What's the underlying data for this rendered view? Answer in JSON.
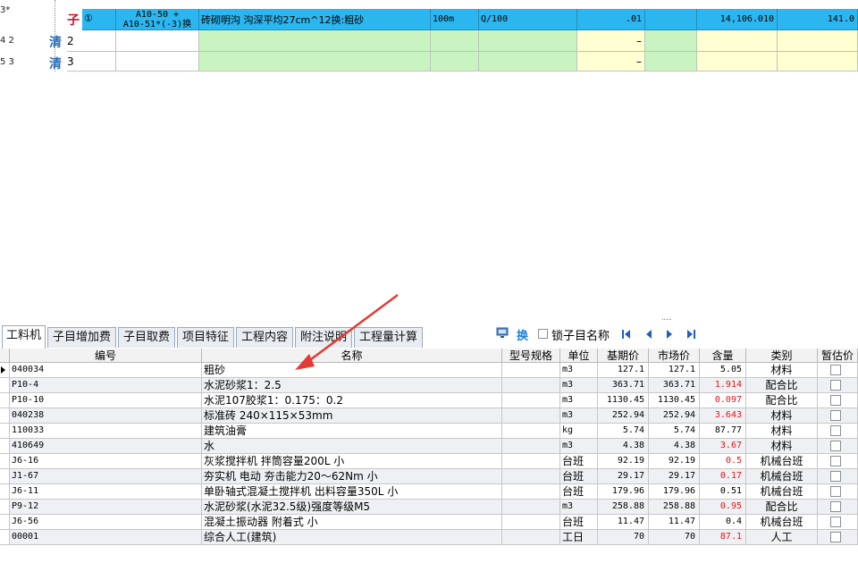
{
  "top_grid": {
    "row_numbers": [
      "3*",
      "4 2",
      "5 3"
    ],
    "rows": [
      {
        "marker": "子",
        "index": "①",
        "code_line1": "A10-50 +",
        "code_line2": "A10-51*(-3)换",
        "name": "砖砌明沟 沟深平均27cm^12换:粗砂",
        "unit": "100m",
        "quantity": "Q/100",
        "qty_value": ".01",
        "price": "14,106.010",
        "total": "141.0"
      },
      {
        "marker": "清",
        "index": "2",
        "dash": "–"
      },
      {
        "marker": "清",
        "index": "3",
        "dash": "–"
      }
    ]
  },
  "tabs": [
    "工料机",
    "子目增加费",
    "子目取费",
    "项目特征",
    "工程内容",
    "附注说明",
    "工程量计算"
  ],
  "toolbar": {
    "replace_label": "换",
    "lock_label": "锁子目名称",
    "icons": [
      "monitor-icon",
      "first-icon",
      "prev-icon",
      "next-icon",
      "last-icon"
    ]
  },
  "table": {
    "columns": [
      "编号",
      "名称",
      "型号规格",
      "单位",
      "基期价",
      "市场价",
      "含量",
      "类别",
      "暂估价"
    ],
    "rows": [
      {
        "code": "040034",
        "name": "粗砂",
        "spec": "",
        "unit": "m3",
        "base": "127.1",
        "market": "127.1",
        "amount": "5.05",
        "amount_red": false,
        "category": "材料"
      },
      {
        "code": "P10-4",
        "name": "水泥砂浆1：2.5",
        "spec": "",
        "unit": "m3",
        "base": "363.71",
        "market": "363.71",
        "amount": "1.914",
        "amount_red": true,
        "category": "配合比"
      },
      {
        "code": "P10-10",
        "name": "水泥107胶浆1：0.175：0.2",
        "spec": "",
        "unit": "m3",
        "base": "1130.45",
        "market": "1130.45",
        "amount": "0.097",
        "amount_red": true,
        "category": "配合比"
      },
      {
        "code": "040238",
        "name": "标准砖 240×115×53mm",
        "spec": "",
        "unit": "m3",
        "base": "252.94",
        "market": "252.94",
        "amount": "3.643",
        "amount_red": true,
        "category": "材料"
      },
      {
        "code": "110033",
        "name": "建筑油膏",
        "spec": "",
        "unit": "kg",
        "base": "5.74",
        "market": "5.74",
        "amount": "87.77",
        "amount_red": false,
        "category": "材料"
      },
      {
        "code": "410649",
        "name": "水",
        "spec": "",
        "unit": "m3",
        "base": "4.38",
        "market": "4.38",
        "amount": "3.67",
        "amount_red": true,
        "category": "材料"
      },
      {
        "code": "J6-16",
        "name": "灰浆搅拌机 拌筒容量200L 小",
        "spec": "",
        "unit": "台班",
        "base": "92.19",
        "market": "92.19",
        "amount": "0.5",
        "amount_red": true,
        "category": "机械台班"
      },
      {
        "code": "J1-67",
        "name": "夯实机 电动 夯击能力20～62Nm 小",
        "spec": "",
        "unit": "台班",
        "base": "29.17",
        "market": "29.17",
        "amount": "0.17",
        "amount_red": true,
        "category": "机械台班"
      },
      {
        "code": "J6-11",
        "name": "单卧轴式混凝土搅拌机 出料容量350L 小",
        "spec": "",
        "unit": "台班",
        "base": "179.96",
        "market": "179.96",
        "amount": "0.51",
        "amount_red": false,
        "category": "机械台班"
      },
      {
        "code": "P9-12",
        "name": "水泥砂浆(水泥32.5级)强度等级M5",
        "spec": "",
        "unit": "m3",
        "base": "258.88",
        "market": "258.88",
        "amount": "0.95",
        "amount_red": true,
        "category": "配合比"
      },
      {
        "code": "J6-56",
        "name": "混凝土振动器 附着式 小",
        "spec": "",
        "unit": "台班",
        "base": "11.47",
        "market": "11.47",
        "amount": "0.4",
        "amount_red": false,
        "category": "机械台班"
      },
      {
        "code": "00001",
        "name": "综合人工(建筑)",
        "spec": "",
        "unit": "工日",
        "base": "70",
        "market": "70",
        "amount": "87.1",
        "amount_red": true,
        "category": "人工"
      }
    ]
  },
  "colors": {
    "selected_row": "#2bb6f0",
    "green_cell": "#c9f4c2",
    "yellow_cell": "#ffffd2",
    "red_value": "#e11111",
    "arrow": "#e53935",
    "tree_icon": "#2b6fb5"
  }
}
